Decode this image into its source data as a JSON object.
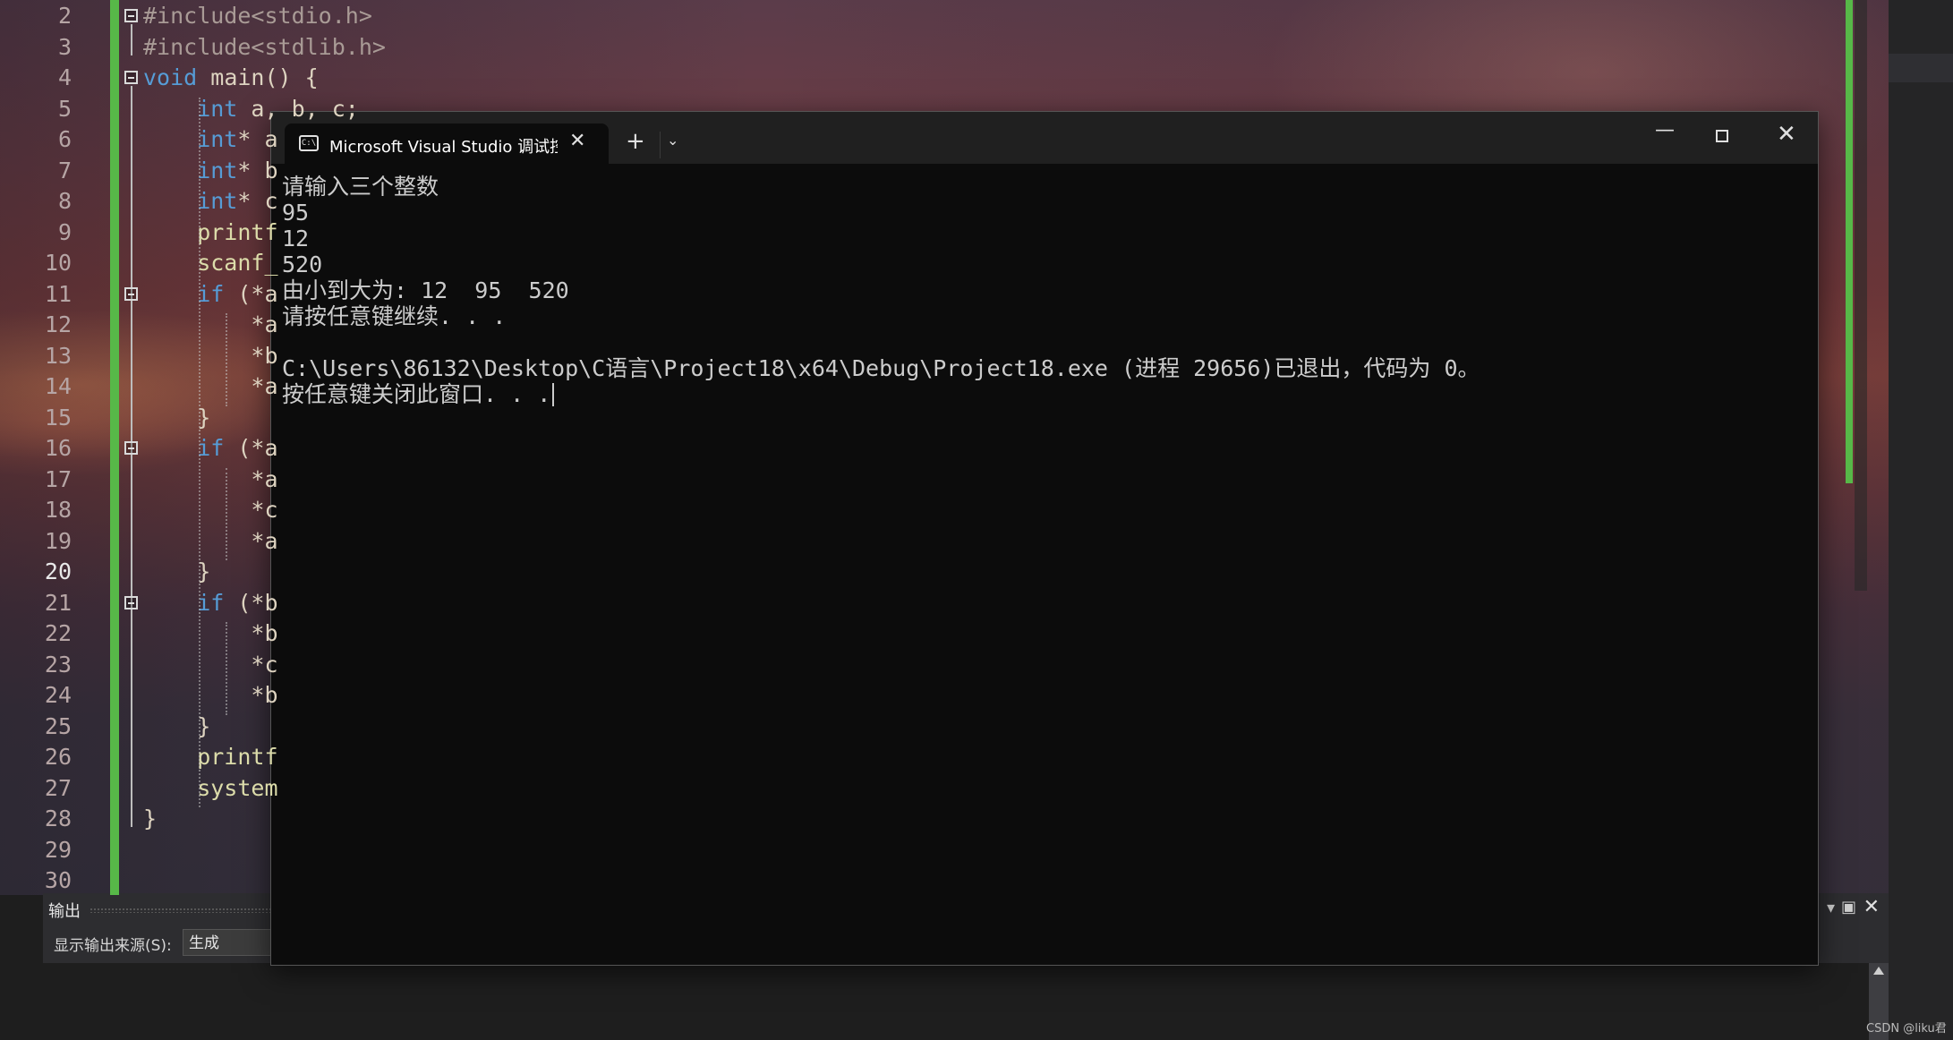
{
  "editor": {
    "line_numbers": [
      "2",
      "3",
      "4",
      "5",
      "6",
      "7",
      "8",
      "9",
      "10",
      "11",
      "12",
      "13",
      "14",
      "15",
      "16",
      "17",
      "18",
      "19",
      "20",
      "21",
      "22",
      "23",
      "24",
      "25",
      "26",
      "27",
      "28",
      "29",
      "30"
    ],
    "active_line": "20",
    "code_lines": [
      {
        "parts": [
          {
            "t": "#include<stdio.h>",
            "c": "pp"
          }
        ]
      },
      {
        "parts": [
          {
            "t": "#include<stdlib.h>",
            "c": "pp"
          }
        ]
      },
      {
        "parts": [
          {
            "t": "void",
            "c": "kw"
          },
          {
            "t": " main() {",
            "c": ""
          }
        ]
      },
      {
        "parts": [
          {
            "t": "    int",
            "c": "kw"
          },
          {
            "t": " a, b, c;",
            "c": ""
          }
        ]
      },
      {
        "parts": [
          {
            "t": "    int",
            "c": "kw"
          },
          {
            "t": "* a",
            "c": ""
          }
        ]
      },
      {
        "parts": [
          {
            "t": "    int",
            "c": "kw"
          },
          {
            "t": "* b",
            "c": ""
          }
        ]
      },
      {
        "parts": [
          {
            "t": "    int",
            "c": "kw"
          },
          {
            "t": "* c",
            "c": ""
          }
        ]
      },
      {
        "parts": [
          {
            "t": "    printf",
            "c": "fn"
          }
        ]
      },
      {
        "parts": [
          {
            "t": "    scanf_",
            "c": "fn"
          }
        ]
      },
      {
        "parts": [
          {
            "t": "    if",
            "c": "kw"
          },
          {
            "t": " (*a",
            "c": ""
          }
        ]
      },
      {
        "parts": [
          {
            "t": "        *a",
            "c": ""
          }
        ]
      },
      {
        "parts": [
          {
            "t": "        *b",
            "c": ""
          }
        ]
      },
      {
        "parts": [
          {
            "t": "        *a",
            "c": ""
          }
        ]
      },
      {
        "parts": [
          {
            "t": "    }",
            "c": ""
          }
        ]
      },
      {
        "parts": [
          {
            "t": "    if",
            "c": "kw"
          },
          {
            "t": " (*a",
            "c": ""
          }
        ]
      },
      {
        "parts": [
          {
            "t": "        *a",
            "c": ""
          }
        ]
      },
      {
        "parts": [
          {
            "t": "        *c",
            "c": ""
          }
        ]
      },
      {
        "parts": [
          {
            "t": "        *a",
            "c": ""
          }
        ]
      },
      {
        "parts": [
          {
            "t": "    }",
            "c": ""
          }
        ]
      },
      {
        "parts": [
          {
            "t": "    if",
            "c": "kw"
          },
          {
            "t": " (*b",
            "c": ""
          }
        ]
      },
      {
        "parts": [
          {
            "t": "        *b",
            "c": ""
          }
        ]
      },
      {
        "parts": [
          {
            "t": "        *c",
            "c": ""
          }
        ]
      },
      {
        "parts": [
          {
            "t": "        *b",
            "c": ""
          }
        ]
      },
      {
        "parts": [
          {
            "t": "    }",
            "c": ""
          }
        ]
      },
      {
        "parts": [
          {
            "t": "    printf",
            "c": "fn"
          }
        ]
      },
      {
        "parts": [
          {
            "t": "    system",
            "c": "fn"
          }
        ]
      },
      {
        "parts": [
          {
            "t": "}",
            "c": ""
          }
        ]
      },
      {
        "parts": []
      },
      {
        "parts": []
      }
    ]
  },
  "terminal": {
    "tab_icon": "C:\\",
    "tab_title": "Microsoft Visual Studio 调试控制台",
    "tab_close": "✕",
    "new_tab": "+",
    "dropdown": "⌄",
    "minimize": "—",
    "close": "✕",
    "lines": [
      "请输入三个整数",
      "95",
      "12",
      "520",
      "由小到大为: 12  95  520",
      "请按任意键继续. . .",
      "",
      "C:\\Users\\86132\\Desktop\\C语言\\Project18\\x64\\Debug\\Project18.exe (进程 29656)已退出，代码为 0。",
      "按任意键关闭此窗口. . ."
    ]
  },
  "output_panel": {
    "title": "输出",
    "source_label": "显示输出来源(S):",
    "source_value": "生成",
    "pin": "▾",
    "maximize": "▣",
    "close": "✕"
  },
  "watermark": "CSDN @liku君",
  "colors": {
    "accent_green": "#57b848",
    "keyword_blue": "#569cd6",
    "console_bg": "#0c0c0c"
  }
}
